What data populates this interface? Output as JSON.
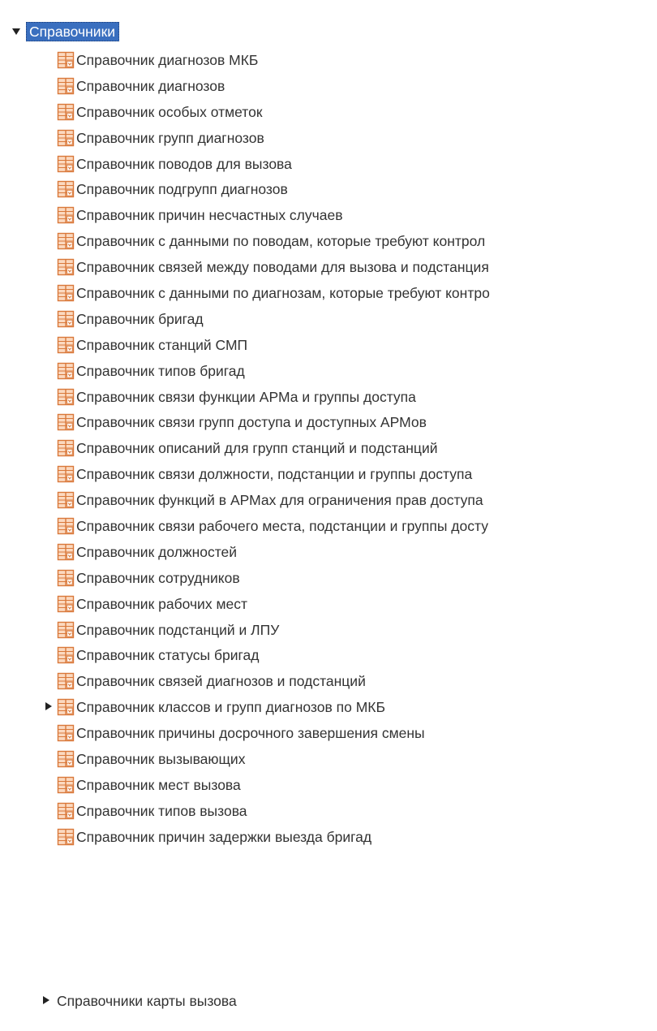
{
  "tree": {
    "root": {
      "label": "Справочники",
      "expanded": true
    },
    "items": [
      {
        "label": "Справочник диагнозов МКБ"
      },
      {
        "label": "Справочник диагнозов"
      },
      {
        "label": "Справочник особых отметок"
      },
      {
        "label": "Справочник групп диагнозов"
      },
      {
        "label": "Справочник поводов для вызова"
      },
      {
        "label": "Справочник подгрупп диагнозов"
      },
      {
        "label": "Справочник причин несчастных случаев"
      },
      {
        "label": "Справочник с данными по поводам, которые требуют контрол"
      },
      {
        "label": "Справочник связей между поводами для вызова и подстанция"
      },
      {
        "label": "Справочник с данными по диагнозам, которые требуют контро"
      },
      {
        "label": "Справочник бригад"
      },
      {
        "label": "Справочник станций СМП"
      },
      {
        "label": "Справочник типов бригад"
      },
      {
        "label": "Справочник связи функции АРМа и группы доступа"
      },
      {
        "label": "Справочник связи групп доступа и доступных АРМов"
      },
      {
        "label": "Справочник описаний для групп станций и подстанций"
      },
      {
        "label": "Справочник связи должности, подстанции и группы доступа"
      },
      {
        "label": "Справочник функций в АРМах для ограничения прав доступа"
      },
      {
        "label": "Справочник связи рабочего места, подстанции и группы досту"
      },
      {
        "label": "Справочник должностей"
      },
      {
        "label": "Справочник сотрудников"
      },
      {
        "label": "Справочник рабочих мест"
      },
      {
        "label": "Справочник подстанций и ЛПУ"
      },
      {
        "label": "Справочник статусы бригад"
      },
      {
        "label": "Справочник связей диагнозов и подстанций"
      },
      {
        "label": "Справочник классов и групп диагнозов по МКБ",
        "has_children": true,
        "expanded": false
      },
      {
        "label": "Справочник причины досрочного завершения смены"
      },
      {
        "label": "Справочник вызывающих"
      },
      {
        "label": "Справочник мест вызова"
      },
      {
        "label": "Справочник типов вызова"
      },
      {
        "label": "Справочник причин задержки выезда бригад"
      }
    ],
    "sibling": {
      "label": "Справочники карты вызова",
      "expanded": false
    }
  },
  "icons": {
    "root_toggle": "expanded-triangle-icon",
    "item_icon": "table-document-icon",
    "collapsed_toggle": "collapsed-triangle-icon"
  },
  "colors": {
    "selection_bg": "#3a6fbf",
    "selection_text": "#ffffff",
    "icon_fill": "#fbd9c0",
    "icon_stroke": "#d9783a",
    "text": "#333333"
  }
}
